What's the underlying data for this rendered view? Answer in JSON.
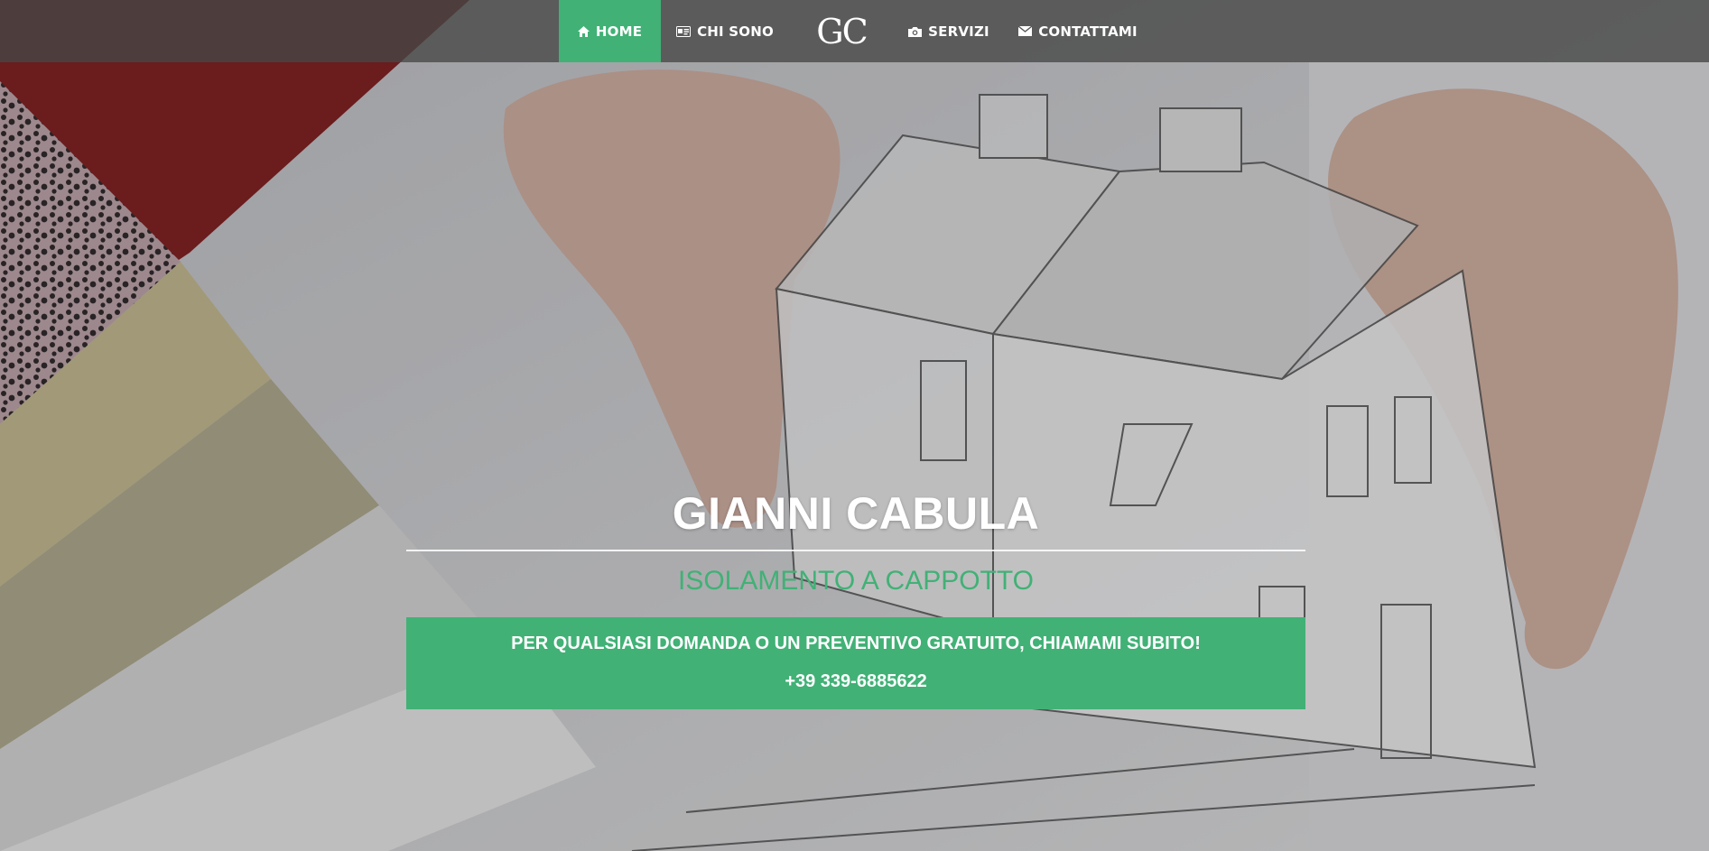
{
  "nav": {
    "items": [
      {
        "label": "HOME",
        "icon": "home-icon",
        "active": true
      },
      {
        "label": "CHI SONO",
        "icon": "id-card-icon",
        "active": false
      },
      {
        "label": "SERVIZI",
        "icon": "camera-icon",
        "active": false
      },
      {
        "label": "CONTATTAMI",
        "icon": "envelope-icon",
        "active": false
      }
    ],
    "logo_text": "GC"
  },
  "hero": {
    "title": "GIANNI CABULA",
    "subtitle": "ISOLAMENTO A CAPPOTTO",
    "cta_text": "PER QUALSIASI DOMANDA O UN PREVENTIVO GRATUITO, CHIAMAMI SUBITO!",
    "phone": "+39 339-6885622"
  },
  "colors": {
    "accent": "#41b176",
    "navbar": "#464646",
    "text": "#ffffff"
  }
}
